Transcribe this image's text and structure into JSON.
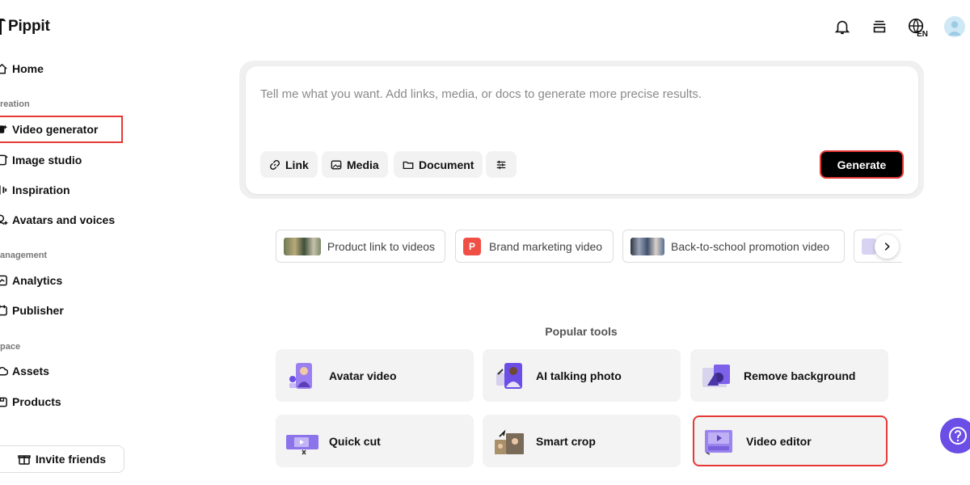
{
  "app": {
    "name": "Pippit"
  },
  "sidebar": {
    "home": "Home",
    "sections": {
      "creation": "reation",
      "management": "anagement",
      "space": "pace"
    },
    "items": [
      {
        "label": "Video generator",
        "icon": "video-sparkle-icon"
      },
      {
        "label": "Image studio",
        "icon": "image-icon"
      },
      {
        "label": "Inspiration",
        "icon": "lightbulb-icon"
      },
      {
        "label": "Avatars and voices",
        "icon": "avatar-sparkle-icon"
      },
      {
        "label": "Analytics",
        "icon": "chart-icon"
      },
      {
        "label": "Publisher",
        "icon": "calendar-icon"
      },
      {
        "label": "Assets",
        "icon": "cloud-icon"
      },
      {
        "label": "Products",
        "icon": "box-icon"
      }
    ],
    "invite": "Invite friends"
  },
  "topbar": {
    "language": "EN"
  },
  "prompt": {
    "placeholder": "Tell me what you want. Add links, media, or docs to generate more precise results.",
    "link": "Link",
    "media": "Media",
    "document": "Document",
    "generate": "Generate"
  },
  "suggestions": [
    {
      "label": "Product link to videos"
    },
    {
      "label": "Brand marketing video",
      "badge": "P"
    },
    {
      "label": "Back-to-school promotion video"
    }
  ],
  "popular": {
    "title": "Popular tools",
    "tools": [
      {
        "label": "Avatar video"
      },
      {
        "label": "AI talking photo"
      },
      {
        "label": "Remove background"
      },
      {
        "label": "Quick cut"
      },
      {
        "label": "Smart crop"
      },
      {
        "label": "Video editor"
      }
    ]
  },
  "colors": {
    "accent": "#6b4ee6",
    "highlight": "#e53935",
    "tool_bg": "#f3f3f3"
  }
}
